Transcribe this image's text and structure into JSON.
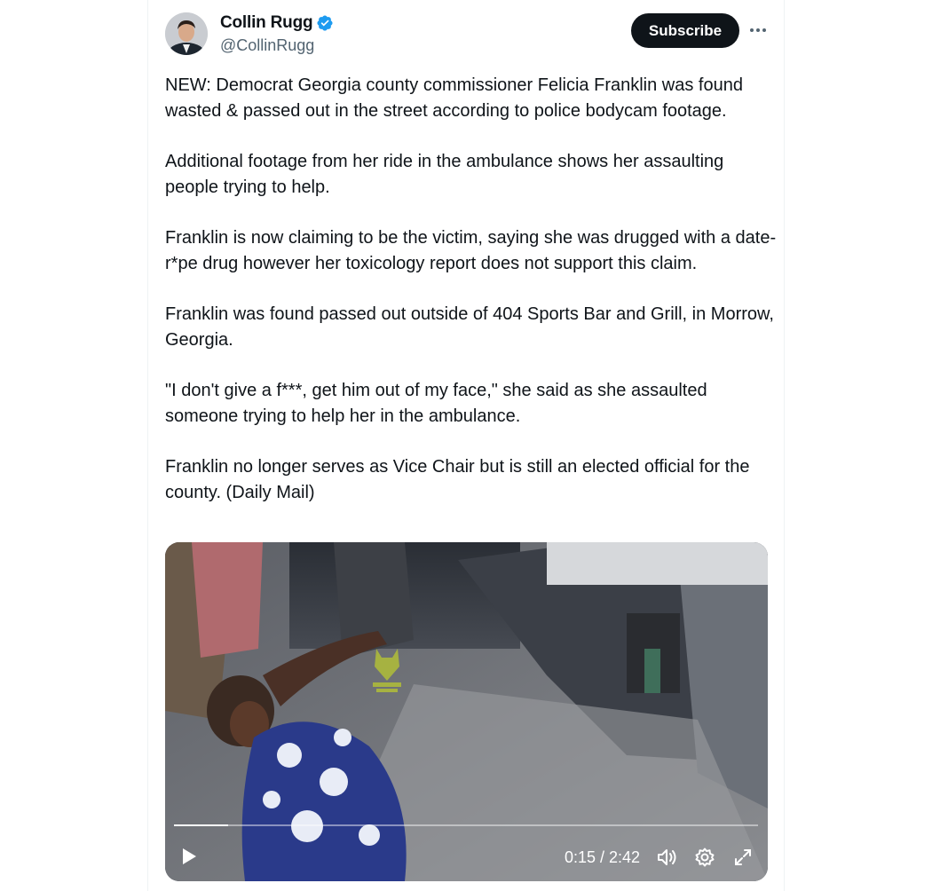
{
  "author": {
    "display_name": "Collin Rugg",
    "handle": "@CollinRugg",
    "verified": true
  },
  "actions": {
    "subscribe_label": "Subscribe",
    "more_icon": "more-horizontal-icon"
  },
  "tweet": {
    "paragraphs": [
      "NEW: Democrat Georgia county commissioner Felicia Franklin was found wasted & passed out in the street according to police bodycam footage.",
      "Additional footage from her ride in the ambulance shows her assaulting people trying to help.",
      "Franklin is now claiming to be the victim, saying she was drugged with a date-r*pe drug however her toxicology report does not support this claim.",
      "Franklin was found passed out outside of 404 Sports Bar and Grill, in Morrow, Georgia.",
      "\"I don't give a f***, get him out of my face,\" she said as she assaulted someone trying to help her in the ambulance.",
      "Franklin no longer serves as Vice Chair but is still an elected official for the county. (Daily Mail)"
    ]
  },
  "video": {
    "current_time": "0:15",
    "duration": "2:42",
    "time_display": "0:15 / 2:42",
    "progress_fraction": 0.093,
    "controls": [
      "play-icon",
      "volume-icon",
      "settings-icon",
      "fullscreen-icon"
    ]
  },
  "colors": {
    "text": "#0f1419",
    "secondary": "#536471",
    "verified_blue": "#1d9bf0",
    "button_bg": "#0f1419"
  }
}
